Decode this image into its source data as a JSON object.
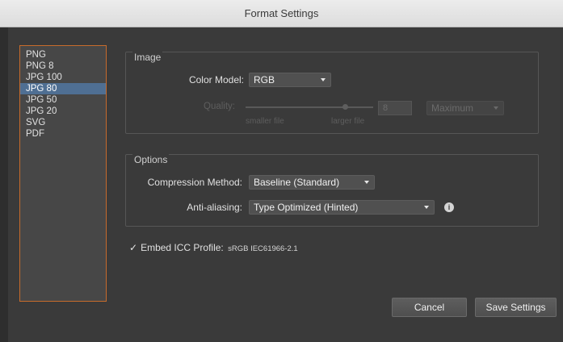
{
  "window": {
    "title": "Format Settings"
  },
  "formats": {
    "items": [
      "PNG",
      "PNG 8",
      "JPG 100",
      "JPG 80",
      "JPG 50",
      "JPG 20",
      "SVG",
      "PDF"
    ],
    "selected_index": 3
  },
  "image": {
    "section_title": "Image",
    "color_model_label": "Color Model:",
    "color_model_value": "RGB",
    "quality_label": "Quality:",
    "quality_value": "8",
    "quality_preset": "Maximum",
    "smaller_file_label": "smaller file",
    "larger_file_label": "larger file"
  },
  "options": {
    "section_title": "Options",
    "compression_label": "Compression Method:",
    "compression_value": "Baseline (Standard)",
    "antialias_label": "Anti-aliasing:",
    "antialias_value": "Type Optimized (Hinted)"
  },
  "icc": {
    "checked": true,
    "label": "Embed ICC Profile:",
    "value": "sRGB IEC61966-2.1"
  },
  "buttons": {
    "cancel": "Cancel",
    "save": "Save Settings"
  },
  "colors": {
    "selection": "#4f6f93",
    "list_border": "#c76b2b",
    "dialog_bg": "#3a3a3a"
  }
}
